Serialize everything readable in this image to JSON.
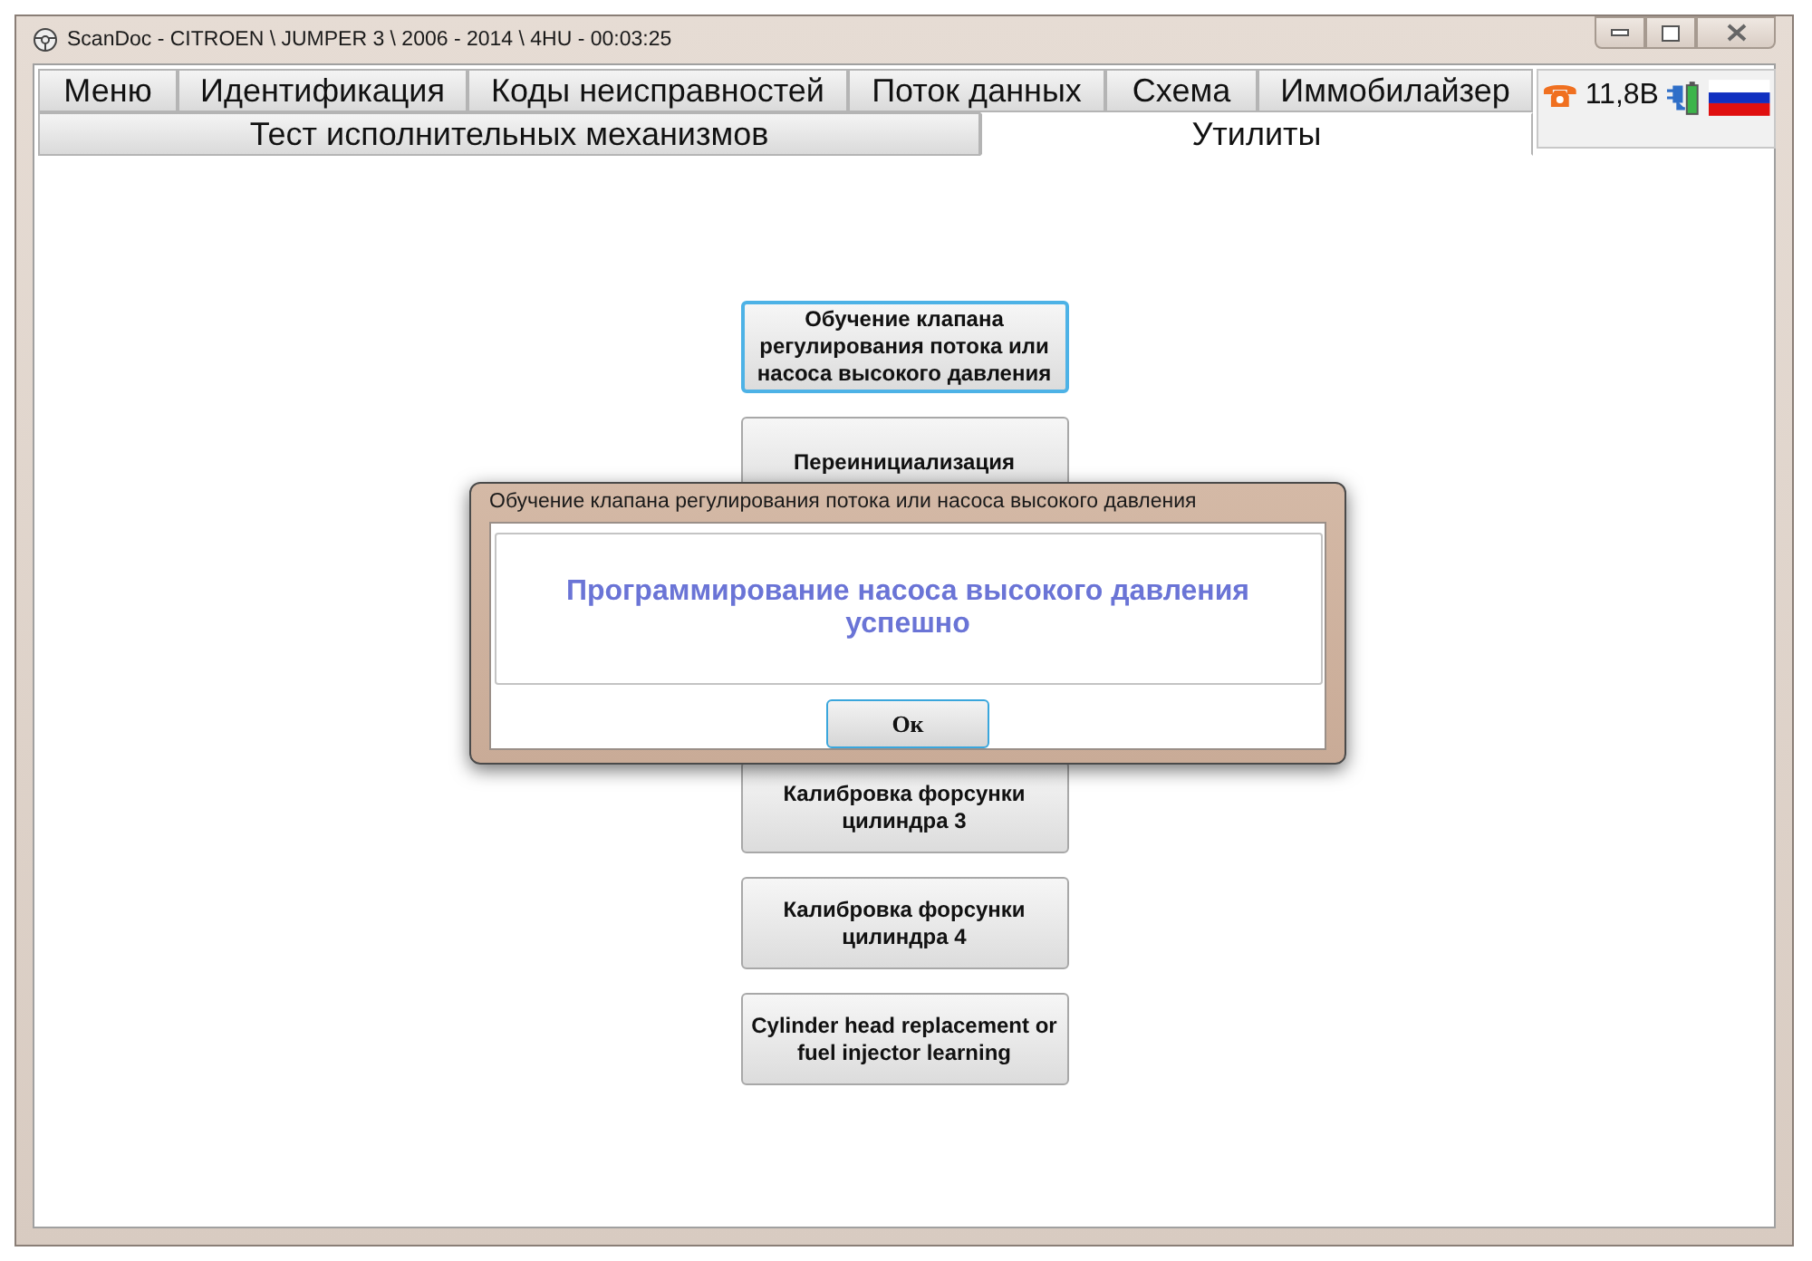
{
  "window": {
    "title": "ScanDoc - CITROEN \\ JUMPER 3 \\ 2006 - 2014 \\ 4HU - 00:03:25"
  },
  "tabs": [
    {
      "label": "Меню",
      "selected": false
    },
    {
      "label": "Идентификация",
      "selected": false
    },
    {
      "label": "Коды неисправностей",
      "selected": false
    },
    {
      "label": "Поток данных",
      "selected": false
    },
    {
      "label": "Схема",
      "selected": false
    },
    {
      "label": "Иммобилайзер",
      "selected": false
    }
  ],
  "subtabs": [
    {
      "label": "Тест исполнительных механизмов",
      "selected": false
    },
    {
      "label": "Утилиты",
      "selected": true
    }
  ],
  "status": {
    "voltage": "11,8В"
  },
  "buttons_top": [
    {
      "label": "Обучение клапана регулирования потока или насоса высокого давления",
      "selected": true
    },
    {
      "label": "Переинициализация",
      "selected": false
    }
  ],
  "buttons_bottom": [
    {
      "label": "Калибровка форсунки цилиндра 3",
      "selected": false
    },
    {
      "label": "Калибровка форсунки цилиндра 4",
      "selected": false
    },
    {
      "label": "Cylinder head replacement or fuel injector learning",
      "selected": false
    }
  ],
  "dialog": {
    "title": "Обучение клапана регулирования потока или насоса высокого давления",
    "message": "Программирование насоса высокого давления успешно",
    "ok": "Ок"
  }
}
